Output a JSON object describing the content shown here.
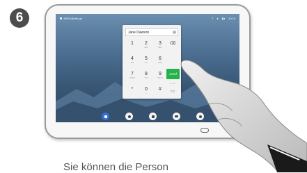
{
  "step": {
    "number": "6"
  },
  "status_bar": {
    "address": "40001@vtfs.ga",
    "time": "10:18"
  },
  "dialer": {
    "entered_text": "Jane Dawson",
    "keys": [
      {
        "digit": "1",
        "letters": ""
      },
      {
        "digit": "2",
        "letters": "ABC"
      },
      {
        "digit": "3",
        "letters": "DEF"
      },
      {
        "digit": "4",
        "letters": "GHI"
      },
      {
        "digit": "5",
        "letters": "JKL"
      },
      {
        "digit": "6",
        "letters": "MNO"
      },
      {
        "digit": "7",
        "letters": "PQRS"
      },
      {
        "digit": "8",
        "letters": "TUV"
      },
      {
        "digit": "9",
        "letters": "WXYZ"
      },
      {
        "digit": "*",
        "letters": ""
      },
      {
        "digit": "0",
        "letters": "+"
      },
      {
        "digit": "#",
        "letters": ""
      }
    ],
    "backspace_icon": "backspace-icon",
    "more_label": "···",
    "call_label": "Anruf",
    "keyboard_icon": "keyboard-icon"
  },
  "bottom_bar": {
    "buttons": [
      {
        "name": "dialpad",
        "icon": "dialpad-icon",
        "active": true
      },
      {
        "name": "contacts",
        "icon": "person-icon",
        "active": false
      },
      {
        "name": "camera",
        "icon": "camera-icon",
        "active": false
      },
      {
        "name": "share",
        "icon": "share-icon",
        "active": false
      },
      {
        "name": "settings",
        "icon": "settings-icon",
        "active": false
      }
    ]
  },
  "caption": "Sie können die Person",
  "colors": {
    "call_green": "#26b24a",
    "active_blue": "#3a6fd8",
    "badge": "#4d4d4d"
  }
}
